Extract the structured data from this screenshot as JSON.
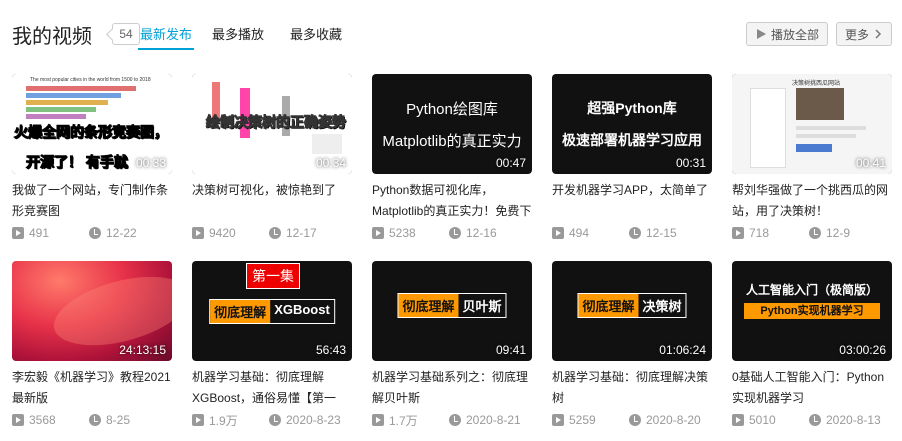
{
  "header": {
    "title": "我的视频",
    "count": "54",
    "tabs": [
      "最新发布",
      "最多播放",
      "最多收藏"
    ],
    "play_all": "播放全部",
    "more": "更多"
  },
  "videos": [
    {
      "title": "我做了一个网站，专门制作条形竞赛图",
      "duration": "00:33",
      "views": "491",
      "date": "12-22",
      "thumb_title": "The most popular cities in the world from 1500 to 2018",
      "thumb_line1": "火爆全网的条形竞赛图，",
      "thumb_line2": "开源了！ 有手就"
    },
    {
      "title": "决策树可视化，被惊艳到了",
      "duration": "00:34",
      "views": "9420",
      "date": "12-17",
      "thumb_line1": "绘制决策树的正确姿势"
    },
    {
      "title": "Python数据可视化库，Matplotlib的真正实力！免费下",
      "duration": "00:47",
      "views": "5238",
      "date": "12-16",
      "thumb_line1": "Python绘图库",
      "thumb_line2": "Matplotlib的真正实力"
    },
    {
      "title": "开发机器学习APP，太简单了",
      "duration": "00:31",
      "views": "494",
      "date": "12-15",
      "thumb_line1": "超强Python库",
      "thumb_line2": "极速部署机器学习应用"
    },
    {
      "title": "帮刘华强做了一个挑西瓜的网站，用了决策树！",
      "duration": "00:41",
      "views": "718",
      "date": "12-9",
      "thumb_caption": "决策树挑西瓜网站"
    },
    {
      "title": "李宏毅《机器学习》教程2021最新版",
      "duration": "24:13:15",
      "views": "3568",
      "date": "8-25"
    },
    {
      "title": "机器学习基础：彻底理解XGBoost，通俗易懂【第一",
      "duration": "56:43",
      "views": "1.9万",
      "date": "2020-8-23",
      "thumb_badge": "第一集",
      "thumb_a": "彻底理解",
      "thumb_b": "XGBoost"
    },
    {
      "title": "机器学习基础系列之：彻底理解贝叶斯",
      "duration": "09:41",
      "views": "1.7万",
      "date": "2020-8-21",
      "thumb_a": "彻底理解",
      "thumb_b": "贝叶斯"
    },
    {
      "title": "机器学习基础：彻底理解决策树",
      "duration": "01:06:24",
      "views": "5259",
      "date": "2020-8-20",
      "thumb_a": "彻底理解",
      "thumb_b": "决策树"
    },
    {
      "title": "0基础人工智能入门：Python实现机器学习",
      "duration": "03:00:26",
      "views": "5010",
      "date": "2020-8-13",
      "thumb_line1": "人工智能入门（极简版）",
      "thumb_line2": "Python实现机器学习"
    }
  ]
}
